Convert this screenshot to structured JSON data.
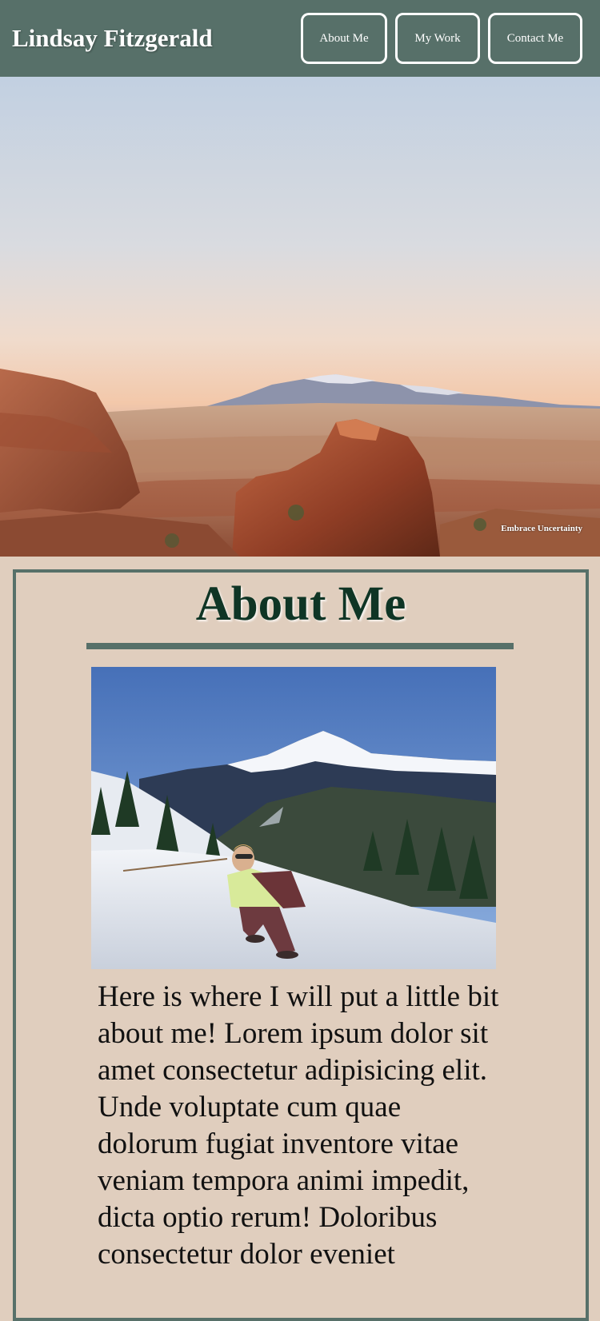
{
  "header": {
    "site_title": "Lindsay Fitzgerald",
    "nav": [
      {
        "label": "About Me"
      },
      {
        "label": "My Work"
      },
      {
        "label": "Contact Me"
      }
    ],
    "background_color": "#577069"
  },
  "hero": {
    "caption": "Embrace Uncertainty"
  },
  "about": {
    "heading": "About Me",
    "body": "Here is where I will put a little bit about me! Lorem ipsum dolor sit amet consectetur adipisicing elit. Unde voluptate cum quae dolorum fugiat inventore vitae veniam tempora animi impedit, dicta optio rerum! Doloribus consectetur dolor eveniet",
    "accent_color": "#577069",
    "heading_color": "#0f3525"
  },
  "page": {
    "background_color": "#e0cebe"
  }
}
